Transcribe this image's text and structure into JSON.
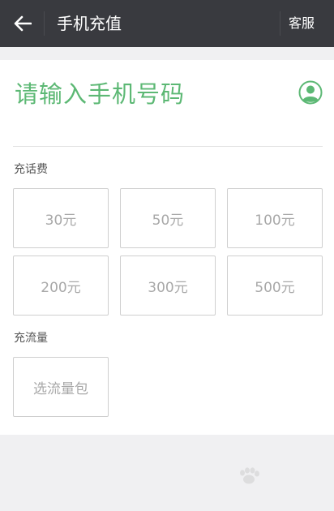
{
  "header": {
    "title": "手机充值",
    "service_label": "客服"
  },
  "phone": {
    "placeholder": "请输入手机号码"
  },
  "recharge_fee": {
    "label": "充话费",
    "options": [
      "30元",
      "50元",
      "100元",
      "200元",
      "300元",
      "500元"
    ]
  },
  "data_plan": {
    "label": "充流量",
    "option": "选流量包"
  },
  "colors": {
    "header_bg": "#393a3f",
    "accent": "#5cb874",
    "page_bg": "#f0f0f2"
  },
  "icons": {
    "back": "back-arrow-icon",
    "contact": "contact-person-icon"
  }
}
